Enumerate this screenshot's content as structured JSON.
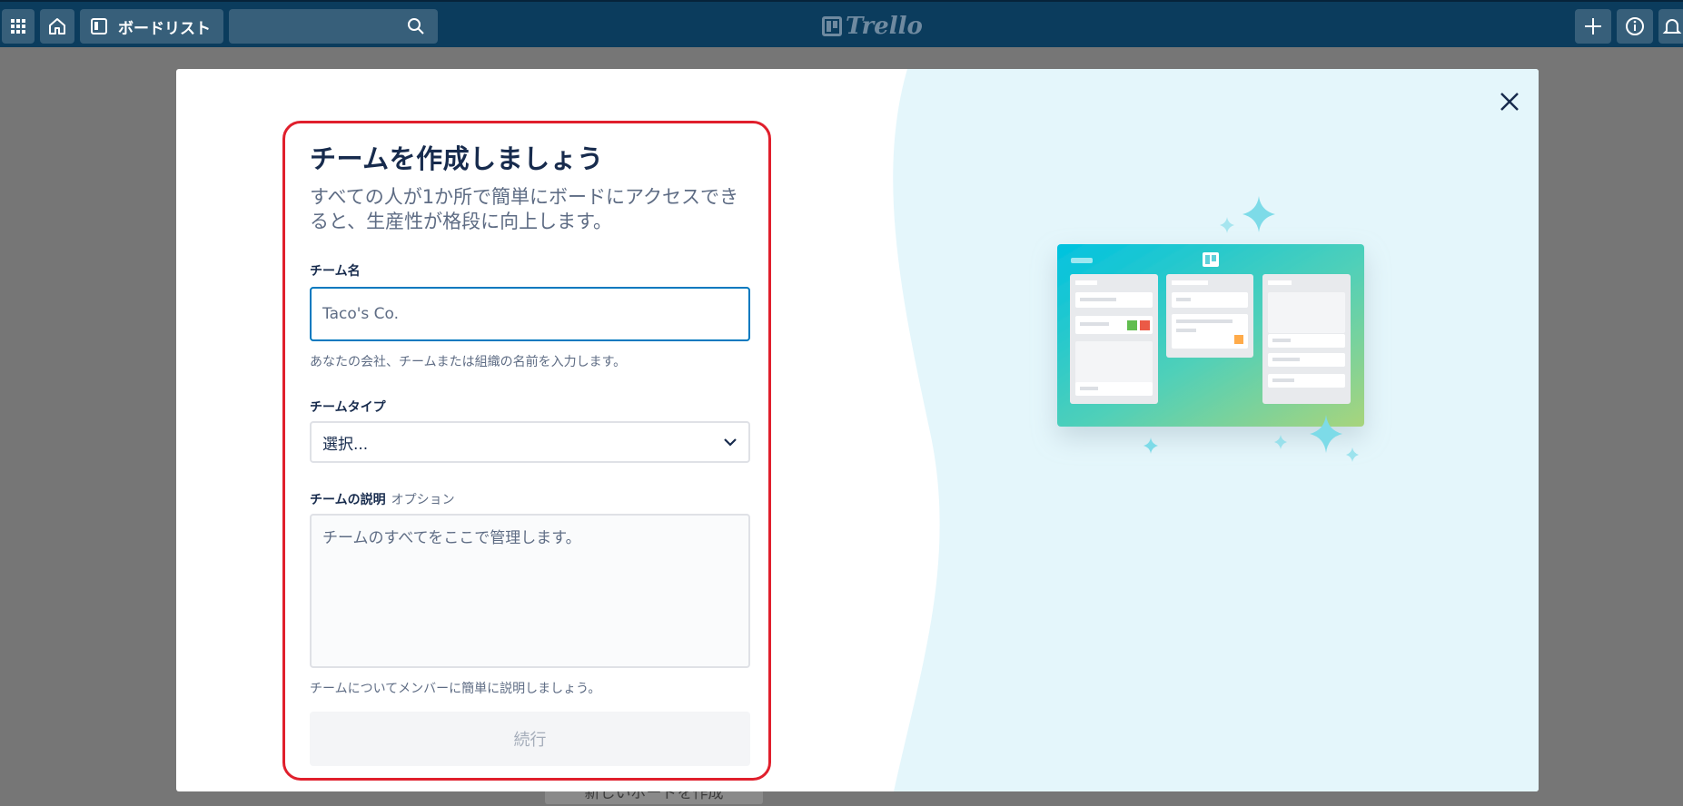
{
  "topbar": {
    "boards_label": "ボードリスト",
    "logo_text": "Trello",
    "icons": [
      "apps-icon",
      "home-icon",
      "board-icon",
      "search-icon",
      "plus-icon",
      "info-icon",
      "bell-icon"
    ]
  },
  "background": {
    "create_board_label": "新しいボードを作成"
  },
  "modal": {
    "title": "チームを作成しましょう",
    "subtitle": "すべての人が1か所で簡単にボードにアクセスできると、生産性が格段に向上します。",
    "team_name": {
      "label": "チーム名",
      "value": "Taco's Co.",
      "hint": "あなたの会社、チームまたは組織の名前を入力します。"
    },
    "team_type": {
      "label": "チームタイプ",
      "selected": "選択..."
    },
    "team_description": {
      "label": "チームの説明",
      "optional": "オプション",
      "placeholder": "チームのすべてをここで管理します。",
      "hint": "チームについてメンバーに簡単に説明しましょう。"
    },
    "continue_label": "続行"
  },
  "colors": {
    "topbar": "#0b3c5d",
    "accent": "#0079bf",
    "highlight_frame": "#e01f2c",
    "panel_bg": "#e4f6fb"
  }
}
